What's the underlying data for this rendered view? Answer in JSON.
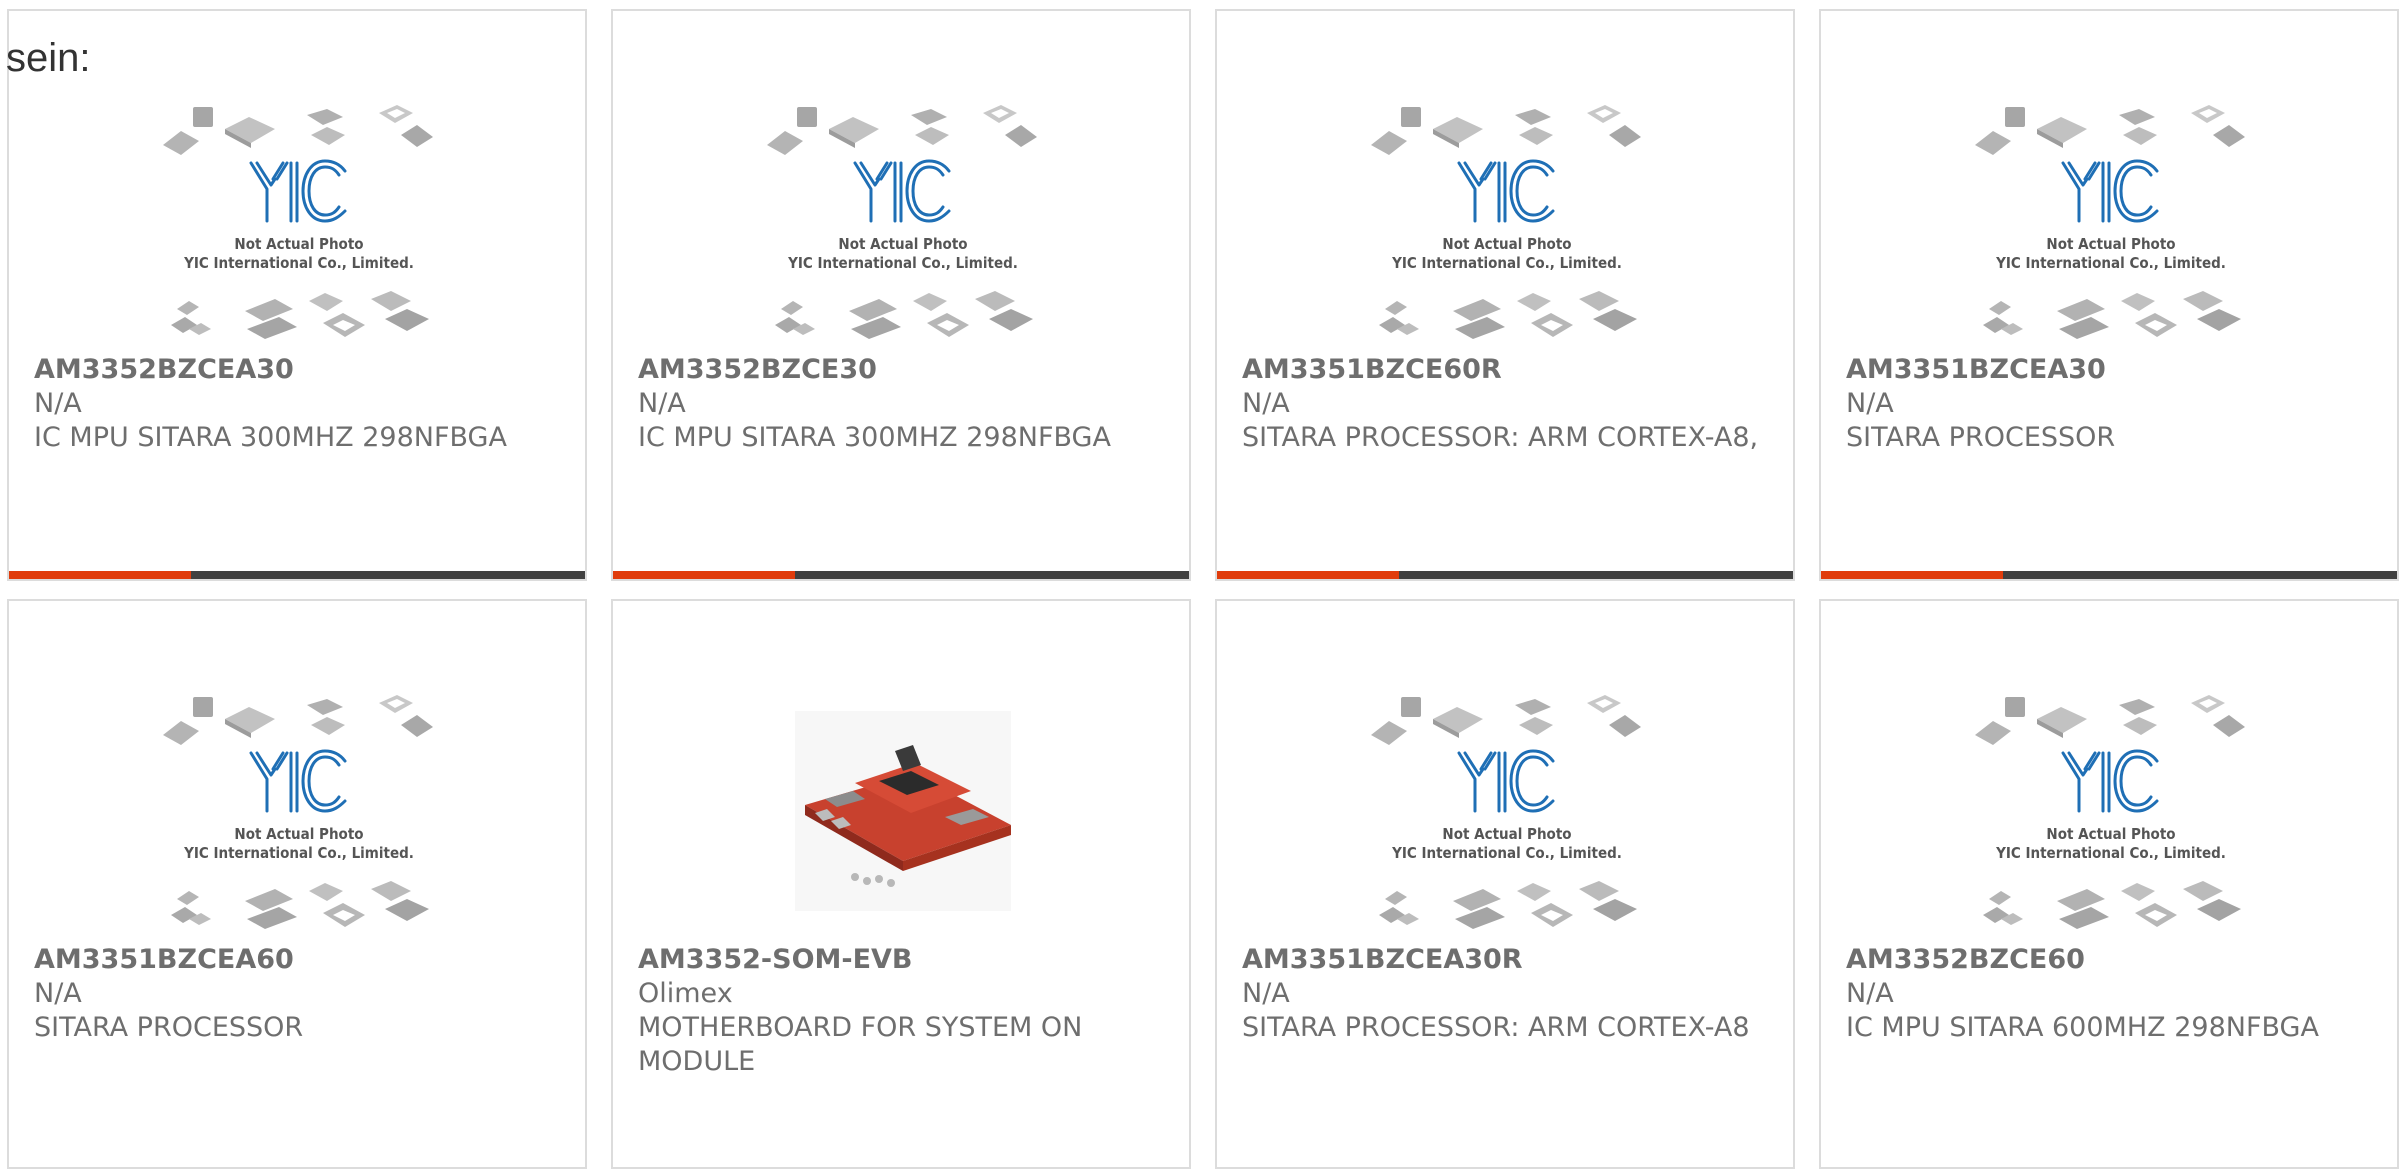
{
  "intro_text": "sein:",
  "placeholder": {
    "logo_text": "YIC",
    "caption_line1": "Not Actual Photo",
    "caption_line2": "YIC International Co., Limited."
  },
  "colors": {
    "accent": "#e03c0c",
    "bar": "#404040",
    "text": "#6e6e6e",
    "logo": "#1f6fb5"
  },
  "products": [
    {
      "part": "AM3352BZCEA30",
      "manufacturer": "N/A",
      "description": "IC MPU SITARA 300MHZ 298NFBGA",
      "image": "placeholder"
    },
    {
      "part": "AM3352BZCE30",
      "manufacturer": "N/A",
      "description": "IC MPU SITARA 300MHZ 298NFBGA",
      "image": "placeholder"
    },
    {
      "part": "AM3351BZCE60R",
      "manufacturer": "N/A",
      "description": "SITARA PROCESSOR: ARM CORTEX-A8,",
      "image": "placeholder"
    },
    {
      "part": "AM3351BZCEA30",
      "manufacturer": "N/A",
      "description": "SITARA PROCESSOR",
      "image": "placeholder"
    },
    {
      "part": "AM3351BZCEA60",
      "manufacturer": "N/A",
      "description": "SITARA PROCESSOR",
      "image": "placeholder"
    },
    {
      "part": "AM3352-SOM-EVB",
      "manufacturer": "Olimex",
      "description": "MOTHERBOARD FOR SYSTEM ON MODULE",
      "image": "board-photo"
    },
    {
      "part": "AM3351BZCEA30R",
      "manufacturer": "N/A",
      "description": "SITARA PROCESSOR: ARM CORTEX-A8",
      "image": "placeholder"
    },
    {
      "part": "AM3352BZCE60",
      "manufacturer": "N/A",
      "description": "IC MPU SITARA 600MHZ 298NFBGA",
      "image": "placeholder"
    }
  ]
}
